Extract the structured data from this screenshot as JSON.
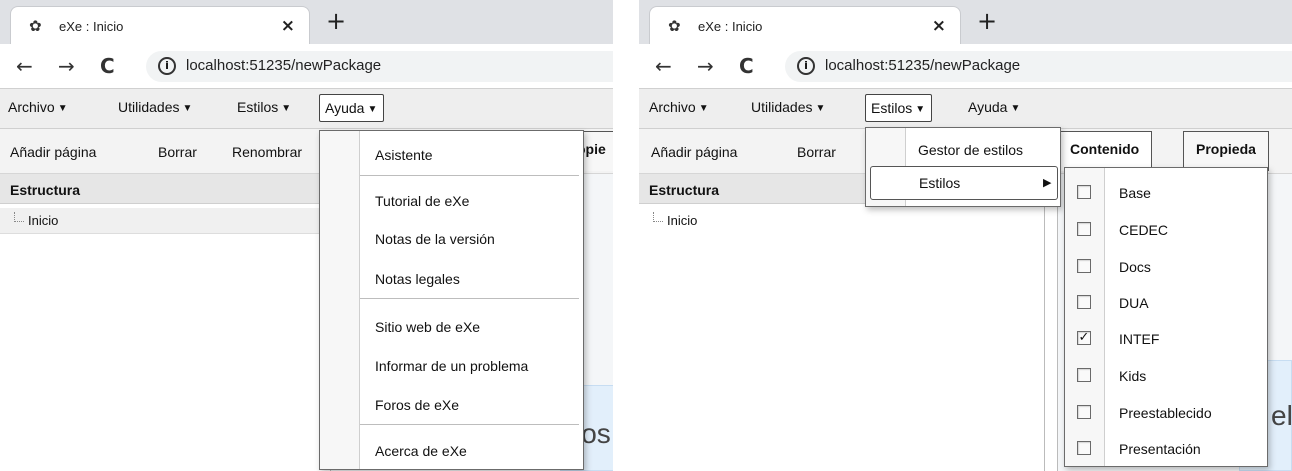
{
  "left": {
    "tab": {
      "icon": "exe-logo-icon",
      "title": "eXe : Inicio",
      "close": "×"
    },
    "new_tab": "+",
    "nav": {
      "back": "←",
      "forward": "→",
      "reload": "C"
    },
    "url": "localhost:51235/newPackage",
    "menubar": {
      "archivo": "Archivo",
      "utilidades": "Utilidades",
      "estilos": "Estilos",
      "ayuda": "Ayuda"
    },
    "toolbar": {
      "add_page": "Añadir página",
      "delete": "Borrar",
      "rename": "Renombrar",
      "props_partial": "opie"
    },
    "tree": {
      "header": "Estructura",
      "root": "Inicio"
    },
    "content_partial": "los",
    "ayuda_menu": {
      "asistente": "Asistente",
      "tutorial": "Tutorial de eXe",
      "notas_version": "Notas de la versión",
      "notas_legales": "Notas legales",
      "sitio_web": "Sitio web de eXe",
      "informar": "Informar de un problema",
      "foros": "Foros de eXe",
      "acerca": "Acerca de eXe"
    }
  },
  "right": {
    "tab": {
      "icon": "exe-logo-icon",
      "title": "eXe : Inicio",
      "close": "×"
    },
    "new_tab": "+",
    "nav": {
      "back": "←",
      "forward": "→",
      "reload": "C"
    },
    "url": "localhost:51235/newPackage",
    "menubar": {
      "archivo": "Archivo",
      "utilidades": "Utilidades",
      "estilos": "Estilos",
      "ayuda": "Ayuda"
    },
    "toolbar": {
      "add_page": "Añadir página",
      "delete": "Borrar"
    },
    "content_tabs": {
      "contenido": "Contenido",
      "propiedades_partial": "Propieda"
    },
    "tree": {
      "header": "Estructura",
      "root": "Inicio"
    },
    "content_partial": "el",
    "estilos_menu": {
      "gestor": "Gestor de estilos",
      "estilos": "Estilos"
    },
    "styles_submenu": [
      {
        "label": "Base",
        "checked": false,
        "mark": ""
      },
      {
        "label": "CEDEC",
        "checked": false,
        "mark": ""
      },
      {
        "label": "Docs",
        "checked": false,
        "mark": ""
      },
      {
        "label": "DUA",
        "checked": false,
        "mark": ""
      },
      {
        "label": "INTEF",
        "checked": true,
        "mark": "✓"
      },
      {
        "label": "Kids",
        "checked": false,
        "mark": ""
      },
      {
        "label": "Preestablecido",
        "checked": false,
        "mark": ""
      },
      {
        "label": "Presentación",
        "checked": false,
        "mark": ""
      }
    ]
  }
}
